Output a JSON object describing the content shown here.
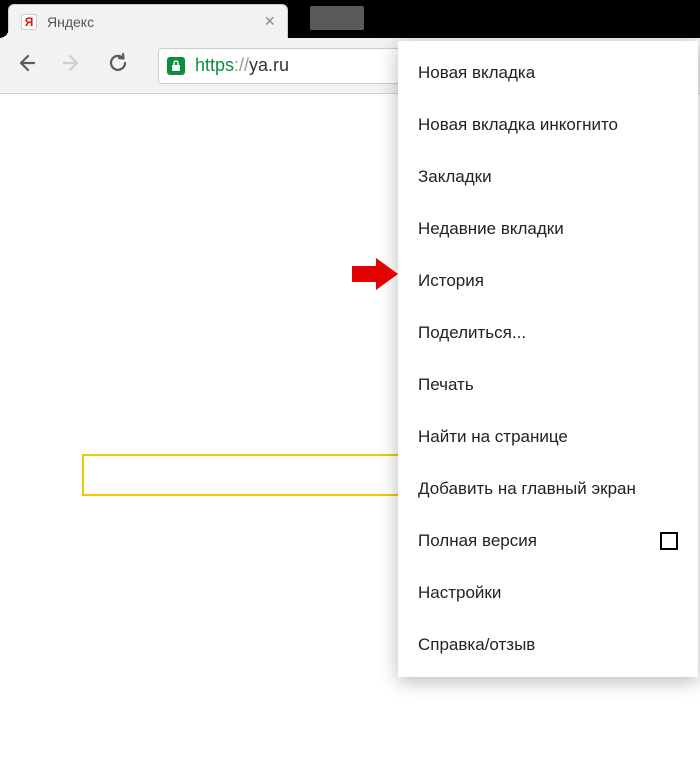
{
  "tab": {
    "title": "Яндекс",
    "favicon_letter": "Я"
  },
  "toolbar": {
    "url_scheme": "https",
    "url_sep": "://",
    "url_host": "ya.ru"
  },
  "menu": {
    "items": [
      {
        "label": "Новая вкладка",
        "checkbox": false
      },
      {
        "label": "Новая вкладка инкогнито",
        "checkbox": false
      },
      {
        "label": "Закладки",
        "checkbox": false
      },
      {
        "label": "Недавние вкладки",
        "checkbox": false
      },
      {
        "label": "История",
        "checkbox": false
      },
      {
        "label": "Поделиться...",
        "checkbox": false
      },
      {
        "label": "Печать",
        "checkbox": false
      },
      {
        "label": "Найти на странице",
        "checkbox": false
      },
      {
        "label": "Добавить на главный экран",
        "checkbox": false
      },
      {
        "label": "Полная версия",
        "checkbox": true
      },
      {
        "label": "Настройки",
        "checkbox": false
      },
      {
        "label": "Справка/отзыв",
        "checkbox": false
      }
    ]
  },
  "annotation": {
    "arrow_target_index": 4,
    "arrow_color": "#e30000"
  }
}
